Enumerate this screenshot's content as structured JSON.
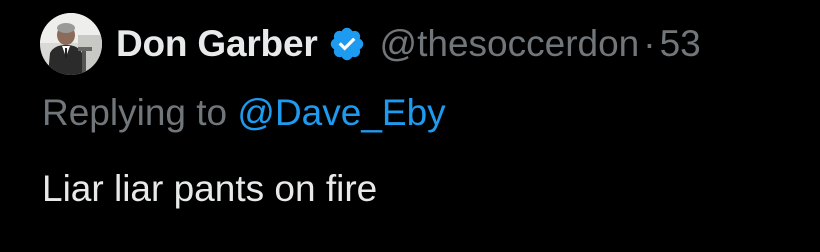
{
  "tweet": {
    "author": {
      "display_name": "Don Garber",
      "handle": "@thesoccerdon",
      "verified": true,
      "verified_icon": "verified-badge-icon",
      "avatar": "profile-photo"
    },
    "separator": "·",
    "timestamp": "53",
    "reply": {
      "prefix": "Replying to",
      "target": "@Dave_Eby"
    },
    "text": "Liar liar pants on fire"
  },
  "colors": {
    "background": "#000000",
    "primary_text": "#e7e9ea",
    "secondary_text": "#71767b",
    "link": "#1d9bf0",
    "verified": "#1d9bf0"
  }
}
